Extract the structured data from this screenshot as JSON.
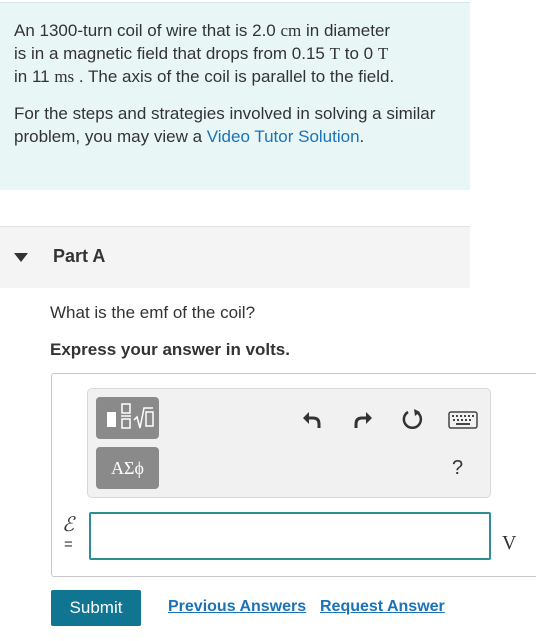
{
  "problem": {
    "line1_pre": "An 1300-turn coil of wire that is 2.0 ",
    "unit_cm": "cm",
    "line1_post": " in diameter",
    "line2_pre": "is in a magnetic field that drops from 0.15 ",
    "unit_T1": "T",
    "line2_mid": " to 0 ",
    "unit_T2": "T",
    "line3_pre": "in 11 ",
    "unit_ms": "ms",
    "line3_post": " . The axis of the coil is parallel to the field.",
    "help_text": "For the steps and strategies involved in solving a similar problem, you may view a ",
    "help_link": "Video Tutor Solution",
    "help_end": "."
  },
  "part": {
    "label": "Part A",
    "question": "What is the emf of the coil?",
    "instruction": "Express your answer in volts."
  },
  "toolbar": {
    "template_icon": "fraction-sqrt-template-icon",
    "greek_label": "ΑΣϕ",
    "undo_icon": "undo-icon",
    "redo_icon": "redo-icon",
    "reset_icon": "reset-icon",
    "keyboard_icon": "keyboard-icon",
    "help_label": "?"
  },
  "answer": {
    "variable": "ℰ",
    "equals": "=",
    "value": "",
    "unit": "V"
  },
  "actions": {
    "submit_label": "Submit",
    "previous_answers": "Previous Answers",
    "request_answer": "Request Answer"
  },
  "colors": {
    "problem_bg": "#e9f6f6",
    "link": "#1a73b8",
    "submit_bg": "#0f7591",
    "input_border": "#2d8c96"
  }
}
